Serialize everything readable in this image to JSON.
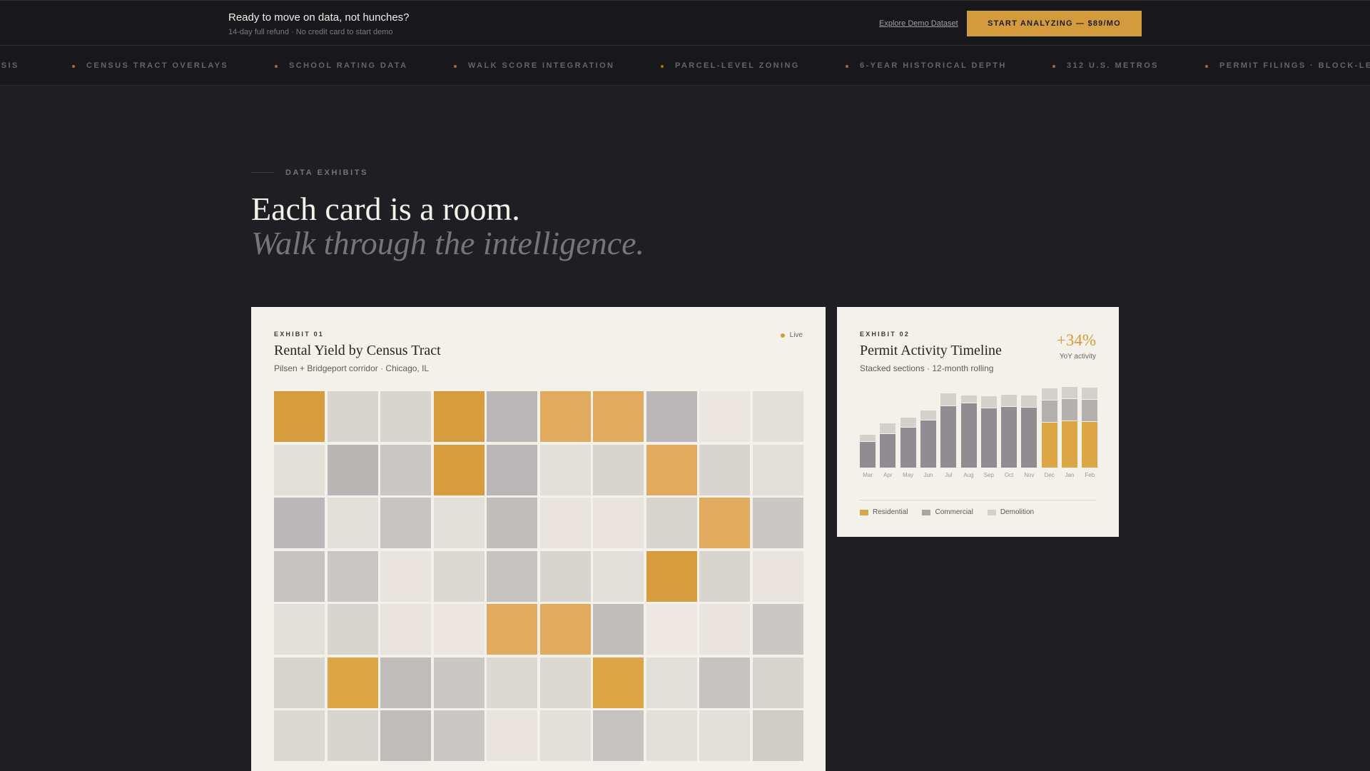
{
  "topbar": {
    "title": "Ready to move on data, not hunches?",
    "subtitle": "14-day full refund · No credit card to start demo",
    "demo_link": "Explore Demo Dataset",
    "cta": "START ANALYZING — $89/MO"
  },
  "ticker": {
    "items": [
      "YSIS",
      "CENSUS TRACT OVERLAYS",
      "SCHOOL RATING DATA",
      "WALK SCORE INTEGRATION",
      "PARCEL-LEVEL ZONING",
      "6-YEAR HISTORICAL DEPTH",
      "312 U.S. METROS",
      "PERMIT FILINGS · BLOCK-LE"
    ]
  },
  "section": {
    "eyebrow": "DATA EXHIBITS",
    "heading": "Each card is a room.",
    "heading_italic": "Walk through the intelligence."
  },
  "exhibit1": {
    "label": "EXHIBIT 01",
    "title": "Rental Yield by Census Tract",
    "subtitle": "Pilsen + Bridgeport corridor · Chicago, IL",
    "status": "Live",
    "grid_colors": [
      [
        "#d79c3d",
        "#d8d5cf",
        "#d8d5cf",
        "#d79c3d",
        "#b9b7b8",
        "#e0ab5e",
        "#e0ab5e",
        "#b9b7b8",
        "#ebe7e0",
        "#e3dfd9"
      ],
      [
        "#e3dfd9",
        "#b9b7b5",
        "#cac8c6",
        "#d79c3d",
        "#b9b7b8",
        "#e3dfd9",
        "#d8d5cf",
        "#e0ab5e",
        "#d8d5cf",
        "#e3dfd9"
      ],
      [
        "#b9b7b8",
        "#e3dfd9",
        "#c7c4c1",
        "#e3dfd9",
        "#c0bdbb",
        "#e9e5de",
        "#e9e5de",
        "#d8d5cf",
        "#e0ab5e",
        "#cac7c4"
      ],
      [
        "#c6c3c0",
        "#cac7c4",
        "#e9e5de",
        "#dcd9d3",
        "#c6c3c0",
        "#d8d5cf",
        "#e3dfd9",
        "#d79c3d",
        "#d8d5cf",
        "#e9e5de"
      ],
      [
        "#e3dfd9",
        "#d8d5cf",
        "#e9e5de",
        "#ebe7e0",
        "#e0ab5e",
        "#e0ab5e",
        "#c0bdbb",
        "#ede9e2",
        "#e9e5de",
        "#cac7c4"
      ],
      [
        "#d8d5cf",
        "#dca546",
        "#bfbcba",
        "#cac7c4",
        "#dcd9d3",
        "#dcd9d3",
        "#dca546",
        "#e3dfd9",
        "#c6c3c0",
        "#d8d5cf"
      ],
      [
        "#dcd9d3",
        "#d8d5cf",
        "#bfbcba",
        "#cac7c4",
        "#e9e5de",
        "#e3dfd9",
        "#c6c3c0",
        "#e3dfd9",
        "#e3dfd9",
        "#d0cdc9"
      ]
    ]
  },
  "exhibit2": {
    "label": "EXHIBIT 02",
    "title": "Permit Activity Timeline",
    "subtitle": "Stacked sections · 12-month rolling",
    "kpi_value": "+34%",
    "kpi_label": "YoY activity",
    "colors": {
      "residential": "#dca546",
      "commercial": "#8f8d92",
      "commercial_light": "#b3b0ad",
      "demolition": "#d4d1cc"
    },
    "legend": [
      {
        "label": "Residential",
        "color": "#dca546"
      },
      {
        "label": "Commercial",
        "color": "#a9a7a4"
      },
      {
        "label": "Demolition",
        "color": "#d4d1cc"
      }
    ]
  },
  "chart_data": {
    "type": "bar",
    "stacked": true,
    "title": "Permit Activity Timeline",
    "categories": [
      "Mar",
      "Apr",
      "May",
      "Jun",
      "Jul",
      "Aug",
      "Sep",
      "Oct",
      "Nov",
      "Dec",
      "Jan",
      "Feb"
    ],
    "series": [
      {
        "name": "Residential",
        "values": [
          0,
          0,
          0,
          0,
          0,
          0,
          0,
          0,
          0,
          57,
          59,
          58
        ]
      },
      {
        "name": "Commercial",
        "values": [
          33,
          43,
          51,
          60,
          78,
          81,
          75,
          77,
          76,
          28,
          28,
          28
        ]
      },
      {
        "name": "Demolition",
        "values": [
          9,
          13,
          12,
          12,
          16,
          10,
          15,
          15,
          15,
          15,
          15,
          15
        ]
      }
    ],
    "ylim": [
      0,
      100
    ]
  }
}
